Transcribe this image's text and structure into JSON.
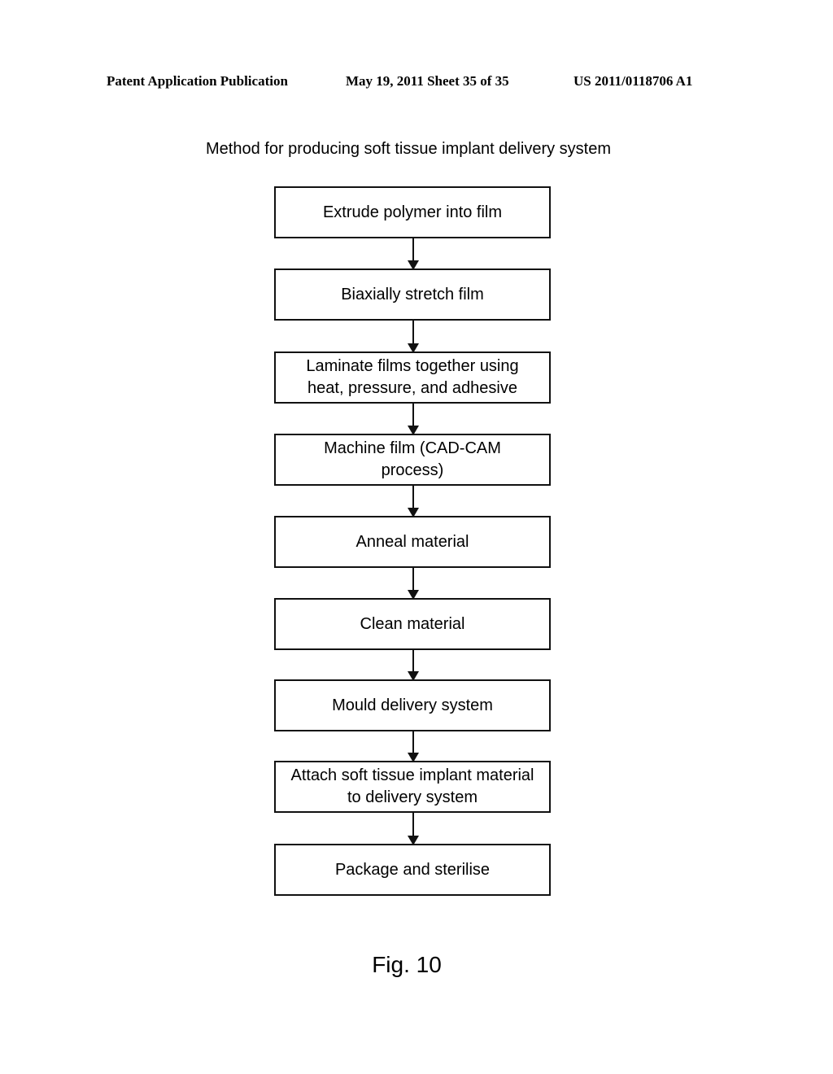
{
  "header": {
    "publication": "Patent Application Publication",
    "date_sheet": "May 19, 2011  Sheet 35 of 35",
    "number": "US 2011/0118706 A1"
  },
  "diagram": {
    "title": "Method for producing soft tissue implant delivery system",
    "steps": [
      {
        "label": "Extrude polymer into film"
      },
      {
        "label": "Biaxially stretch film"
      },
      {
        "label": "Laminate films together using heat, pressure, and adhesive"
      },
      {
        "label": "Machine film (CAD-CAM process)"
      },
      {
        "label": "Anneal material"
      },
      {
        "label": "Clean material"
      },
      {
        "label": "Mould delivery system"
      },
      {
        "label": "Attach soft tissue implant material to delivery system"
      },
      {
        "label": "Package and sterilise"
      }
    ],
    "figure_label": "Fig. 10"
  }
}
